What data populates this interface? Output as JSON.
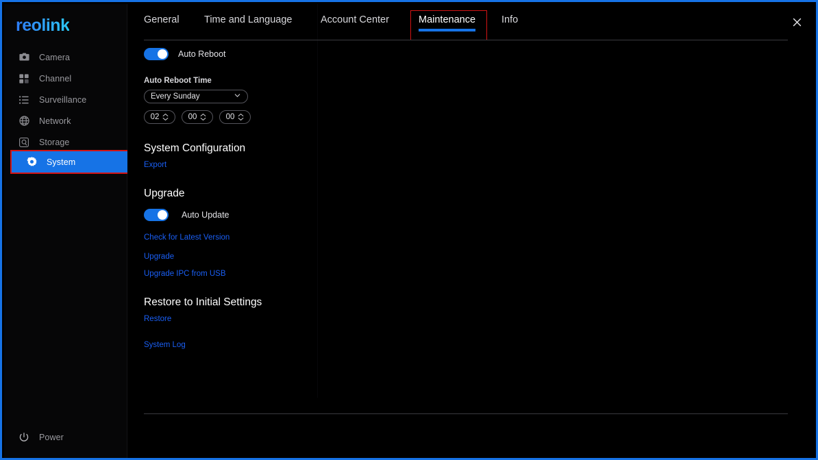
{
  "window": {
    "accent_color": "#1673e6",
    "link_color": "#1a5ff5",
    "annotation_color": "#d41414",
    "close_label": "×"
  },
  "sidebar": {
    "brand": "reolink",
    "items": [
      {
        "label": "Camera",
        "icon": "camera-icon",
        "active": false
      },
      {
        "label": "Channel",
        "icon": "grid-icon",
        "active": false
      },
      {
        "label": "Surveillance",
        "icon": "list-icon",
        "active": false
      },
      {
        "label": "Network",
        "icon": "globe-icon",
        "active": false
      },
      {
        "label": "Storage",
        "icon": "hard-drive-icon",
        "active": false
      },
      {
        "label": "System",
        "icon": "gear-icon",
        "active": true
      }
    ],
    "power": {
      "label": "Power",
      "icon": "power-icon"
    }
  },
  "tabs": [
    {
      "id": "general",
      "label": "General",
      "active": false
    },
    {
      "id": "time",
      "label": "Time and Language",
      "active": false
    },
    {
      "id": "account",
      "label": "Account Center",
      "active": false
    },
    {
      "id": "maintenance",
      "label": "Maintenance",
      "active": true
    },
    {
      "id": "info",
      "label": "Info",
      "active": false
    }
  ],
  "maintenance": {
    "auto_reboot": {
      "toggle_label": "Auto Reboot",
      "toggle_state": "on",
      "time_label": "Auto Reboot Time",
      "schedule_value": "Every Sunday",
      "hour": "02",
      "minute": "00",
      "second": "00"
    },
    "system_configuration": {
      "title": "System Configuration",
      "export_label": "Export"
    },
    "upgrade": {
      "title": "Upgrade",
      "auto_update_label": "Auto Update",
      "auto_update_state": "on",
      "check_label": "Check for Latest Version",
      "upgrade_label": "Upgrade",
      "upgrade_ipc_label": "Upgrade IPC from USB"
    },
    "restore": {
      "title": "Restore to Initial Settings",
      "restore_label": "Restore"
    },
    "system_log_label": "System Log"
  }
}
